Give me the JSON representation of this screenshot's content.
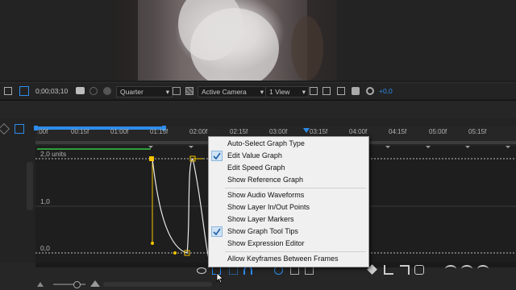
{
  "viewer_bar": {
    "timecode": "0;00;03;10",
    "resolution": "Quarter",
    "camera": "Active Camera",
    "views": "1 View",
    "exposure": "+0,0"
  },
  "timeline": {
    "ruler_labels": [
      ":00f",
      "00:15f",
      "01:00f",
      "01:15f",
      "02:00f",
      "02:15f",
      "03:00f",
      "03:15f",
      "04:00f",
      "04:15f",
      "05:00f",
      "05:15f"
    ],
    "playhead_time": "03:15f"
  },
  "graph": {
    "y_labels": [
      "2,0 units",
      "1,0",
      "0,0"
    ]
  },
  "context_menu": {
    "items": [
      {
        "label": "Auto-Select Graph Type",
        "checked": false
      },
      {
        "label": "Edit Value Graph",
        "checked": true
      },
      {
        "label": "Edit Speed Graph",
        "checked": false
      },
      {
        "label": "Show Reference Graph",
        "checked": false
      },
      {
        "label": "Show Audio Waveforms",
        "checked": false
      },
      {
        "label": "Show Layer In/Out Points",
        "checked": false
      },
      {
        "label": "Show Layer Markers",
        "checked": false
      },
      {
        "label": "Show Graph Tool Tips",
        "checked": true
      },
      {
        "label": "Show Expression Editor",
        "checked": false
      },
      {
        "label": "Allow Keyframes Between Frames",
        "checked": false
      }
    ]
  },
  "colors": {
    "accent": "#2d8ceb",
    "keyframe": "#f5c400",
    "menu_bg": "#f0f0f0",
    "panel_bg": "#232323"
  }
}
